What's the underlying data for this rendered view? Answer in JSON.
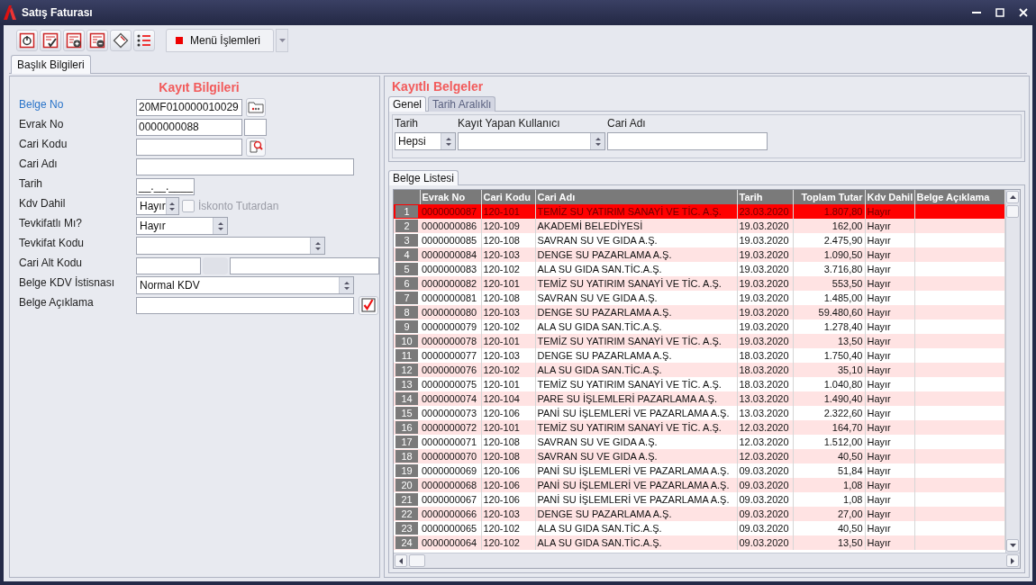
{
  "window": {
    "title": "Satış Faturası"
  },
  "toolbar": {
    "buttons": [
      {
        "kind": "power"
      },
      {
        "kind": "approve"
      },
      {
        "kind": "add"
      },
      {
        "kind": "remove"
      },
      {
        "kind": "tag"
      },
      {
        "kind": "list"
      }
    ],
    "menu": {
      "label": "Menü İşlemleri"
    }
  },
  "tabs": [
    {
      "label": "Başlık Bilgileri",
      "selected": true
    }
  ],
  "record": {
    "title": "Kayıt Bilgileri",
    "fields": [
      {
        "label": "Belge No",
        "kind": "picker",
        "value": "20MF010000010029",
        "highlighted": true
      },
      {
        "label": "Evrak No",
        "kind": "counter",
        "value": "0000000088",
        "highlighted": false
      },
      {
        "label": "Cari Kodu",
        "kind": "lookup",
        "highlighted": false
      },
      {
        "label": "Cari Adı",
        "kind": "wide",
        "highlighted": false
      },
      {
        "label": "Tarih",
        "kind": "date",
        "value": "__.__.____",
        "highlighted": false
      },
      {
        "label": "Kdv Dahil",
        "kind": "spin-check",
        "value": "Hayır",
        "highlighted": false,
        "option": {
          "label": "İskonto Tutardan",
          "checked": false,
          "disabled": true
        }
      },
      {
        "label": "Tevkifatlı Mı?",
        "kind": "select",
        "value": "Hayır",
        "highlighted": false
      },
      {
        "label": "Tevkifat Kodu",
        "kind": "select-wide",
        "highlighted": false
      },
      {
        "label": "Cari Alt Kodu",
        "kind": "split",
        "highlighted": false
      },
      {
        "label": "Belge KDV İstisnası",
        "kind": "select-long",
        "value": "Normal KDV",
        "highlighted": false
      },
      {
        "label": "Belge Açıklama",
        "kind": "confirm",
        "highlighted": false
      }
    ]
  },
  "documents": {
    "title": "Kayıtlı Belgeler",
    "filter_tabs": [
      {
        "label": "Genel",
        "selected": true
      },
      {
        "label": "Tarih Aralıklı",
        "selected": false
      }
    ],
    "filters": [
      {
        "label": "Tarih",
        "kind": "select-short",
        "value": "Hepsi"
      },
      {
        "label": "Kayıt Yapan Kullanıcı",
        "kind": "select"
      },
      {
        "label": "Cari Adı",
        "kind": "text"
      }
    ],
    "list_tab": {
      "label": "Belge Listesi"
    },
    "columns": [
      "Evrak No",
      "Cari Kodu",
      "Cari Adı",
      "Tarih",
      "Toplam Tutar",
      "Kdv Dahil",
      "Belge Açıklama"
    ],
    "rows": [
      {
        "number": "1",
        "cells": [
          "0000000087",
          "120-101",
          "TEMİZ SU YATIRIM SANAYİ VE TİC. A.Ş.",
          "23.03.2020",
          "1.807,80",
          "Hayır"
        ],
        "selected": true
      },
      {
        "number": "2",
        "cells": [
          "0000000086",
          "120-109",
          "AKADEMİ BELEDİYESİ",
          "19.03.2020",
          "162,00",
          "Hayır"
        ],
        "selected": false
      },
      {
        "number": "3",
        "cells": [
          "0000000085",
          "120-108",
          "SAVRAN SU VE GIDA A.Ş.",
          "19.03.2020",
          "2.475,90",
          "Hayır"
        ],
        "selected": false
      },
      {
        "number": "4",
        "cells": [
          "0000000084",
          "120-103",
          "DENGE SU PAZARLAMA A.Ş.",
          "19.03.2020",
          "1.090,50",
          "Hayır"
        ],
        "selected": false
      },
      {
        "number": "5",
        "cells": [
          "0000000083",
          "120-102",
          "ALA SU GIDA SAN.TİC.A.Ş.",
          "19.03.2020",
          "3.716,80",
          "Hayır"
        ],
        "selected": false
      },
      {
        "number": "6",
        "cells": [
          "0000000082",
          "120-101",
          "TEMİZ SU YATIRIM SANAYİ VE TİC. A.Ş.",
          "19.03.2020",
          "553,50",
          "Hayır"
        ],
        "selected": false
      },
      {
        "number": "7",
        "cells": [
          "0000000081",
          "120-108",
          "SAVRAN SU VE GIDA A.Ş.",
          "19.03.2020",
          "1.485,00",
          "Hayır"
        ],
        "selected": false
      },
      {
        "number": "8",
        "cells": [
          "0000000080",
          "120-103",
          "DENGE SU PAZARLAMA A.Ş.",
          "19.03.2020",
          "59.480,60",
          "Hayır"
        ],
        "selected": false
      },
      {
        "number": "9",
        "cells": [
          "0000000079",
          "120-102",
          "ALA SU GIDA SAN.TİC.A.Ş.",
          "19.03.2020",
          "1.278,40",
          "Hayır"
        ],
        "selected": false
      },
      {
        "number": "10",
        "cells": [
          "0000000078",
          "120-101",
          "TEMİZ SU YATIRIM SANAYİ VE TİC. A.Ş.",
          "19.03.2020",
          "13,50",
          "Hayır"
        ],
        "selected": false
      },
      {
        "number": "11",
        "cells": [
          "0000000077",
          "120-103",
          "DENGE SU PAZARLAMA A.Ş.",
          "18.03.2020",
          "1.750,40",
          "Hayır"
        ],
        "selected": false
      },
      {
        "number": "12",
        "cells": [
          "0000000076",
          "120-102",
          "ALA SU GIDA SAN.TİC.A.Ş.",
          "18.03.2020",
          "35,10",
          "Hayır"
        ],
        "selected": false
      },
      {
        "number": "13",
        "cells": [
          "0000000075",
          "120-101",
          "TEMİZ SU YATIRIM SANAYİ VE TİC. A.Ş.",
          "18.03.2020",
          "1.040,80",
          "Hayır"
        ],
        "selected": false
      },
      {
        "number": "14",
        "cells": [
          "0000000074",
          "120-104",
          "PARE SU İŞLEMLERİ PAZARLAMA A.Ş.",
          "13.03.2020",
          "1.490,40",
          "Hayır"
        ],
        "selected": false
      },
      {
        "number": "15",
        "cells": [
          "0000000073",
          "120-106",
          "PANİ SU İŞLEMLERİ VE PAZARLAMA A.Ş.",
          "13.03.2020",
          "2.322,60",
          "Hayır"
        ],
        "selected": false
      },
      {
        "number": "16",
        "cells": [
          "0000000072",
          "120-101",
          "TEMİZ SU YATIRIM SANAYİ VE TİC. A.Ş.",
          "12.03.2020",
          "164,70",
          "Hayır"
        ],
        "selected": false
      },
      {
        "number": "17",
        "cells": [
          "0000000071",
          "120-108",
          "SAVRAN SU VE GIDA A.Ş.",
          "12.03.2020",
          "1.512,00",
          "Hayır"
        ],
        "selected": false
      },
      {
        "number": "18",
        "cells": [
          "0000000070",
          "120-108",
          "SAVRAN SU VE GIDA A.Ş.",
          "12.03.2020",
          "40,50",
          "Hayır"
        ],
        "selected": false
      },
      {
        "number": "19",
        "cells": [
          "0000000069",
          "120-106",
          "PANİ SU İŞLEMLERİ VE PAZARLAMA A.Ş.",
          "09.03.2020",
          "51,84",
          "Hayır"
        ],
        "selected": false
      },
      {
        "number": "20",
        "cells": [
          "0000000068",
          "120-106",
          "PANİ SU İŞLEMLERİ VE PAZARLAMA A.Ş.",
          "09.03.2020",
          "1,08",
          "Hayır"
        ],
        "selected": false
      },
      {
        "number": "21",
        "cells": [
          "0000000067",
          "120-106",
          "PANİ SU İŞLEMLERİ VE PAZARLAMA A.Ş.",
          "09.03.2020",
          "1,08",
          "Hayır"
        ],
        "selected": false
      },
      {
        "number": "22",
        "cells": [
          "0000000066",
          "120-103",
          "DENGE SU PAZARLAMA A.Ş.",
          "09.03.2020",
          "27,00",
          "Hayır"
        ],
        "selected": false
      },
      {
        "number": "23",
        "cells": [
          "0000000065",
          "120-102",
          "ALA SU GIDA SAN.TİC.A.Ş.",
          "09.03.2020",
          "40,50",
          "Hayır"
        ],
        "selected": false
      },
      {
        "number": "24",
        "cells": [
          "0000000064",
          "120-102",
          "ALA SU GIDA SAN.TİC.A.Ş.",
          "09.03.2020",
          "13,50",
          "Hayır"
        ],
        "selected": false
      }
    ]
  }
}
